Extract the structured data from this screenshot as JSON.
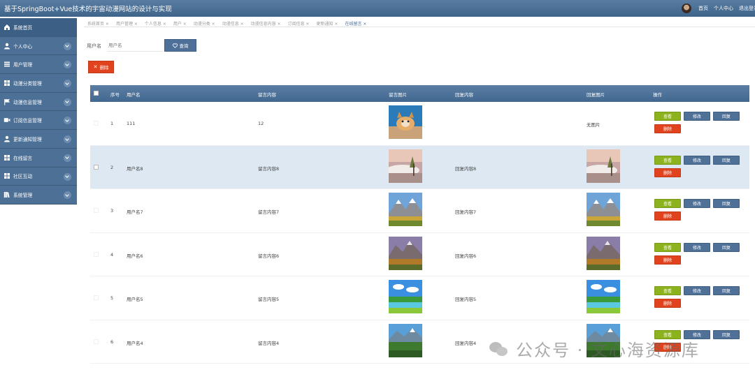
{
  "app": {
    "title": "基于SpringBoot+Vue技术的宇宙动漫网站的设计与实现"
  },
  "header_nav": {
    "home": "首页",
    "profile": "个人中心",
    "logout": "退出登录"
  },
  "sidebar": {
    "items": [
      {
        "label": "系统首页",
        "icon": "home-icon"
      },
      {
        "label": "个人中心",
        "icon": "user-icon"
      },
      {
        "label": "用户管理",
        "icon": "list-icon"
      },
      {
        "label": "动漫分类管理",
        "icon": "grid-icon"
      },
      {
        "label": "动漫信息管理",
        "icon": "flag-icon"
      },
      {
        "label": "订阅信息管理",
        "icon": "video-icon"
      },
      {
        "label": "更新通知管理",
        "icon": "user-icon"
      },
      {
        "label": "在线留言",
        "icon": "grid-icon"
      },
      {
        "label": "社区互动",
        "icon": "grid-icon"
      },
      {
        "label": "系统管理",
        "icon": "books-icon"
      }
    ]
  },
  "tabs": [
    "系统首页 ×",
    "用户管理 ×",
    "个人信息 ×",
    "用户 ×",
    "动漫分类 ×",
    "动漫信息 ×",
    "动漫信息内容 ×",
    "订阅信息 ×",
    "更新通知 ×",
    "在线留言 ×"
  ],
  "search": {
    "label": "用户名",
    "placeholder": "用户名",
    "query_label": "查询"
  },
  "toolbar": {
    "delete_label": "删除"
  },
  "table": {
    "headers": {
      "index": "序号",
      "username": "用户名",
      "content": "留言内容",
      "image": "留言图片",
      "reply": "回复内容",
      "reply_image": "回复图片",
      "actions": "操作"
    },
    "actions": {
      "view": "查看",
      "edit": "修改",
      "reply": "回复",
      "delete": "删除"
    },
    "no_image": "无图片",
    "rows": [
      {
        "index": "1",
        "username": "111",
        "content": "12",
        "reply": "",
        "img": "dog",
        "reply_img": ""
      },
      {
        "index": "2",
        "username": "用户名8",
        "content": "留言内容8",
        "reply": "回复内容8",
        "img": "cloud",
        "reply_img": "cloud"
      },
      {
        "index": "3",
        "username": "用户名7",
        "content": "留言内容7",
        "reply": "回复内容7",
        "img": "mountain",
        "reply_img": "mountain"
      },
      {
        "index": "4",
        "username": "用户名6",
        "content": "留言内容6",
        "reply": "回复内容6",
        "img": "autumn",
        "reply_img": "autumn"
      },
      {
        "index": "5",
        "username": "用户名5",
        "content": "留言内容5",
        "reply": "回复内容5",
        "img": "lake",
        "reply_img": "lake"
      },
      {
        "index": "6",
        "username": "用户名4",
        "content": "留言内容4",
        "reply": "回复内容4",
        "img": "valley",
        "reply_img": "valley"
      }
    ]
  },
  "watermark": "公众号 · 文心海资源库",
  "colors": {
    "header": "#4a6d92",
    "accent": "#4f7198",
    "danger": "#e0431e",
    "success": "#8cb21e",
    "row_highlight": "#dde8f3"
  }
}
